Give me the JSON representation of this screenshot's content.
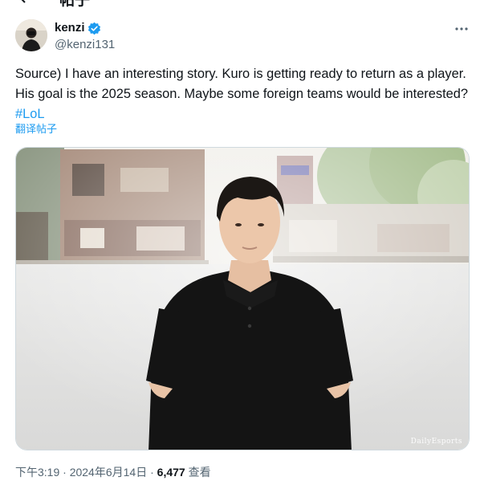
{
  "header": {
    "title": "帖子"
  },
  "author": {
    "name": "kenzi",
    "handle": "@kenzi131",
    "verified": true
  },
  "tweet": {
    "text": "Source) I have an interesting story. Kuro is getting ready to return as a player. His goal is the 2025 season. Maybe some foreign teams would be interested? ",
    "hashtag": "#LoL",
    "translate_label": "翻译帖子"
  },
  "media": {
    "watermark": "DailyEsports"
  },
  "meta": {
    "time": "下午3:19",
    "sep1": " · ",
    "date": "2024年6月14日",
    "sep2": " · ",
    "views": "6,477",
    "views_label": " 查看"
  },
  "icons": {
    "back": "back-arrow-icon",
    "verified": "verified-badge-icon",
    "more": "more-options-icon"
  },
  "colors": {
    "accent": "#1d9bf0",
    "text": "#0f1419",
    "secondary": "#536471",
    "border": "#cfd9de"
  }
}
